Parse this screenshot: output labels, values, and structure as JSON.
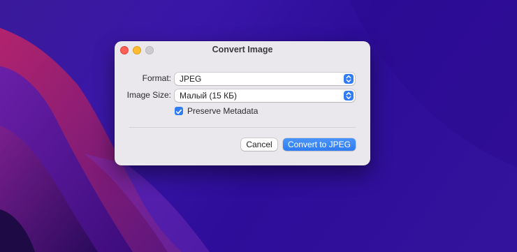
{
  "dialog": {
    "title": "Convert Image",
    "format": {
      "label": "Format:",
      "value": "JPEG"
    },
    "image_size": {
      "label": "Image Size:",
      "value": "Малый (15 КБ)"
    },
    "preserve_metadata": {
      "label": "Preserve Metadata",
      "checked": true
    },
    "cancel_label": "Cancel",
    "convert_label": "Convert to JPEG"
  },
  "colors": {
    "accent": "#2f7cf6",
    "close": "#fe5f57",
    "minimize": "#febc2e",
    "zoom_inactive": "#cdcbcf",
    "dialog_bg": "#ebe8ed"
  },
  "icons": [
    "chevron-up-down-icon",
    "checkmark-icon"
  ]
}
